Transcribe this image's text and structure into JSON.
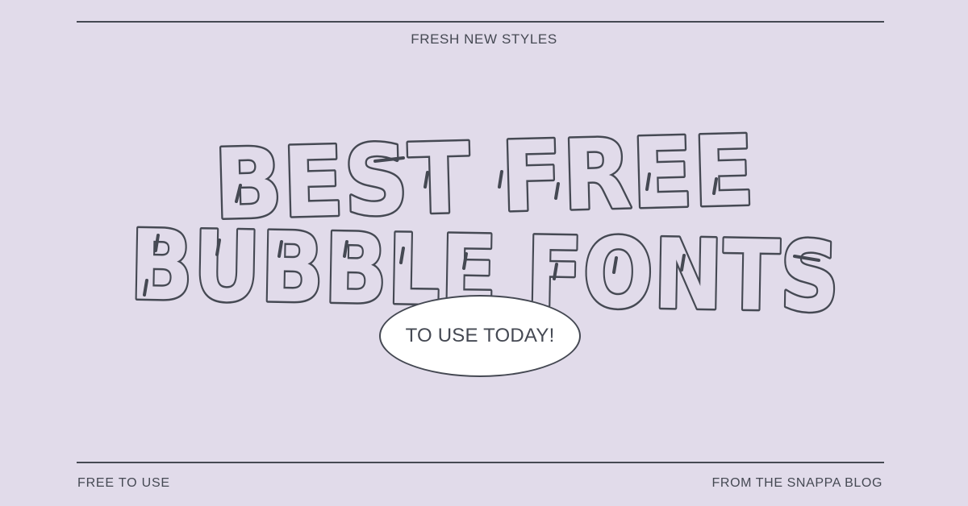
{
  "header": {
    "kicker": "FRESH NEW STYLES"
  },
  "headline": {
    "line1": "BEST FREE",
    "line2": "BUBBLE FONTS"
  },
  "badge": {
    "label": "TO USE TODAY!"
  },
  "footer": {
    "left": "FREE TO USE",
    "right": "FROM THE SNAPPA BLOG"
  },
  "colors": {
    "background": "#e1dbea",
    "ink": "#454953",
    "badge_fill": "#ffffff"
  }
}
